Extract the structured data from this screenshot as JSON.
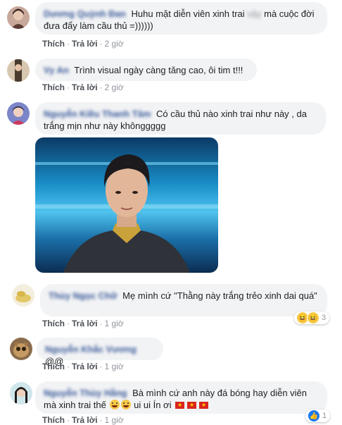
{
  "actions": {
    "like": "Thích",
    "reply": "Trả lời",
    "sep": "·"
  },
  "comments": [
    {
      "author": "Dương Quỳnh Đan",
      "text_before": "Huhu mặt diễn viên xinh trai",
      "hidden": "vậy",
      "text_after": "mà cuộc đời đưa đẩy làm cầu thủ =))))))",
      "time": "2 giờ",
      "avatar_icon": "user-avatar"
    },
    {
      "author": "Vy An",
      "text": "Trình visual ngày càng tăng cao, ôi tim t!!!",
      "time": "2 giờ",
      "avatar_icon": "user-avatar"
    },
    {
      "author": "Nguyễn Kiều Thanh Tâm",
      "text": "Có cầu thủ nào xinh trai như này , da trắng mịn như này khônggggg",
      "avatar_icon": "user-avatar",
      "photo_icon": "player-photo"
    },
    {
      "author": "Thùy Ngọc Chữ",
      "text": "Mẹ mình cứ \"Thằng này trắng trẻo xinh dai quá\"",
      "time": "1 giờ",
      "reactions": {
        "icons": [
          "haha-icon",
          "haha-icon"
        ],
        "count": "3"
      },
      "avatar_icon": "user-avatar"
    },
    {
      "author": "Nguyễn Khắc Vương",
      "text": "@@",
      "time": "1 giờ",
      "avatar_icon": "user-avatar"
    },
    {
      "author": "Nguyễn Thùy Hằng",
      "text_line1": "Bà mình cứ anh này đá bóng hay diễn viên",
      "text_line2_a": "mà xinh trai thế",
      "text_line2_b": "ui ui Ín ơi",
      "time": "1 giờ",
      "reactions": {
        "icons": [
          "like-icon"
        ],
        "count": "1"
      },
      "avatar_icon": "user-avatar"
    }
  ],
  "colors": {
    "bubble": "#f2f3f5",
    "name": "#385898",
    "meta": "#90949c",
    "haha": "#f7c948",
    "like": "#1877f2"
  }
}
